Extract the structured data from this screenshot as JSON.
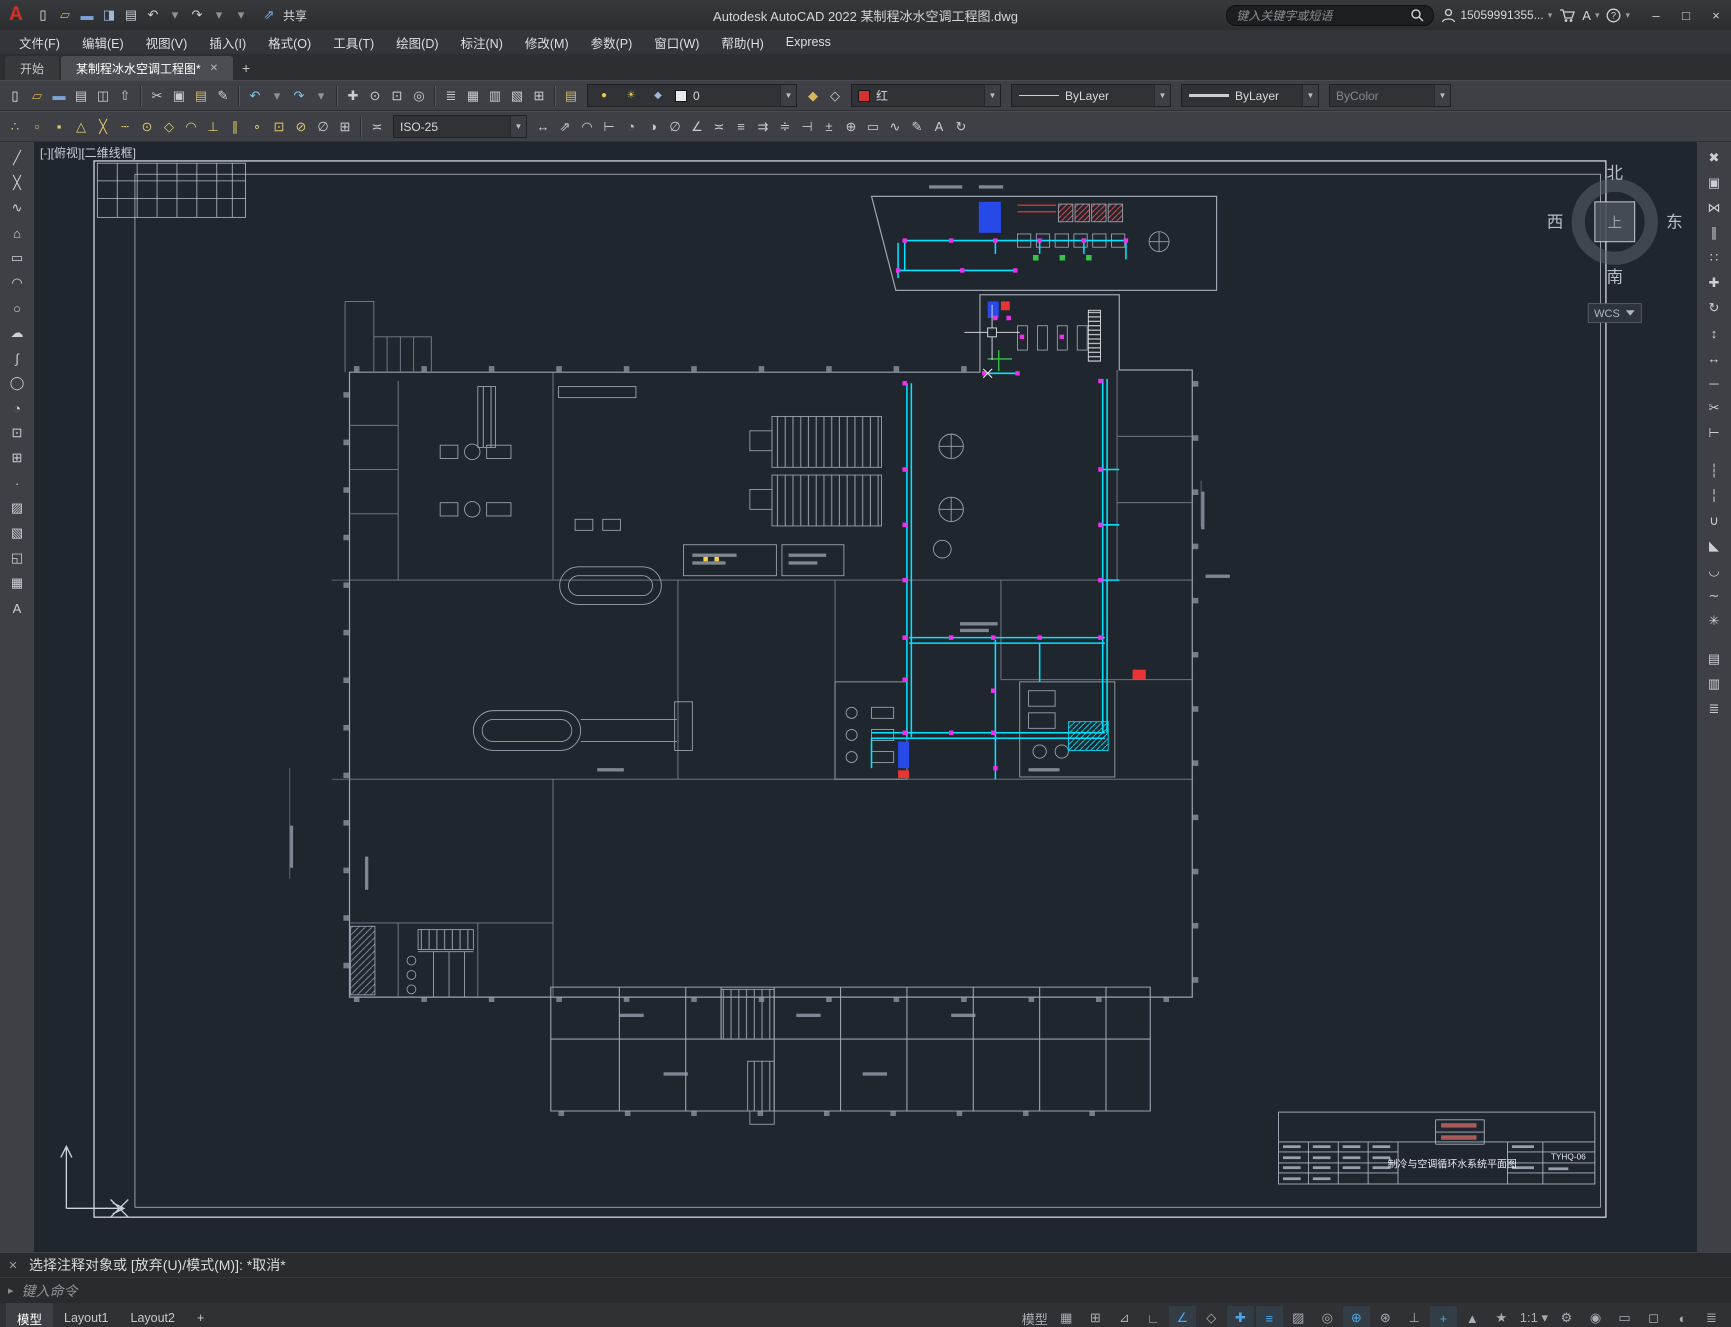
{
  "colors": {
    "canvas_bg": "#20262e",
    "pipe_cyan": "#00e4ff",
    "valve_magenta": "#ee30ee",
    "accent_red": "#d23232"
  },
  "titlebar": {
    "logo": "A",
    "quick_access": [
      {
        "name": "new-icon",
        "g": "▯",
        "c": "#e4e6e9"
      },
      {
        "name": "open-icon",
        "g": "▱",
        "c": "#d9a94f"
      },
      {
        "name": "save-icon",
        "g": "▬",
        "c": "#7da3d8"
      },
      {
        "name": "save-as-icon",
        "g": "◨",
        "c": "#9fb9dd"
      },
      {
        "name": "plot-icon",
        "g": "▤",
        "c": "#c9ccd1"
      },
      {
        "name": "undo-icon",
        "g": "↶",
        "c": "#cfd2d6"
      },
      {
        "name": "undo-caret-icon",
        "g": "▾",
        "c": "#8f9296"
      },
      {
        "name": "redo-icon",
        "g": "↷",
        "c": "#cfd2d6"
      },
      {
        "name": "redo-caret-icon",
        "g": "▾",
        "c": "#8f9296"
      },
      {
        "name": "qat-caret-icon",
        "g": "▾",
        "c": "#8f9296"
      }
    ],
    "share_icon": "⇗",
    "share_label": "共享",
    "title": "Autodesk AutoCAD 2022   某制程冰水空调工程图.dwg",
    "search_placeholder": "键入关键字或短语",
    "right_icons": [
      "search-icon",
      "user-icon",
      "cart-icon",
      "autodesk-a-icon",
      "help-icon"
    ],
    "user_name": "15059991355...",
    "help_label": "?",
    "window_controls": [
      {
        "name": "minimize-button",
        "g": "–"
      },
      {
        "name": "maximize-button",
        "g": "□"
      },
      {
        "name": "close-button",
        "g": "×"
      }
    ]
  },
  "menubar": {
    "items": [
      {
        "name": "menu-file",
        "label": "文件(F)"
      },
      {
        "name": "menu-edit",
        "label": "编辑(E)"
      },
      {
        "name": "menu-view",
        "label": "视图(V)"
      },
      {
        "name": "menu-insert",
        "label": "插入(I)"
      },
      {
        "name": "menu-format",
        "label": "格式(O)"
      },
      {
        "name": "menu-tools",
        "label": "工具(T)"
      },
      {
        "name": "menu-draw",
        "label": "绘图(D)"
      },
      {
        "name": "menu-dimension",
        "label": "标注(N)"
      },
      {
        "name": "menu-modify",
        "label": "修改(M)"
      },
      {
        "name": "menu-parametric",
        "label": "参数(P)"
      },
      {
        "name": "menu-window",
        "label": "窗口(W)"
      },
      {
        "name": "menu-help",
        "label": "帮助(H)"
      },
      {
        "name": "menu-express",
        "label": "Express"
      }
    ]
  },
  "filetabs": {
    "start": "开始",
    "active": "某制程冰水空调工程图*",
    "close": "✕",
    "add": "+"
  },
  "toolbar1": {
    "icons_a": [
      {
        "name": "qnew-icon",
        "g": "▯",
        "c": "#e4e6e9"
      },
      {
        "name": "open-icon",
        "g": "▱",
        "c": "#d9a94f"
      },
      {
        "name": "save-icon",
        "g": "▬",
        "c": "#7da3d8"
      },
      {
        "name": "plot-icon",
        "g": "▤",
        "c": "#c9ccd1"
      },
      {
        "name": "plot-preview-icon",
        "g": "◫",
        "c": "#c9ccd1"
      },
      {
        "name": "publish-icon",
        "g": "⇧",
        "c": "#c9ccd1"
      },
      {
        "sep": true
      },
      {
        "name": "cut-icon",
        "g": "✂",
        "c": "#c9ccd1"
      },
      {
        "name": "copy-clip-icon",
        "g": "▣",
        "c": "#c9ccd1"
      },
      {
        "name": "paste-icon",
        "g": "▤",
        "c": "#d8b65e"
      },
      {
        "name": "match-properties-icon",
        "g": "✎",
        "c": "#c9ccd1"
      },
      {
        "sep": true
      },
      {
        "name": "undo-icon",
        "g": "↶",
        "c": "#86c8e8"
      },
      {
        "name": "undo-caret-icon",
        "g": "▾",
        "c": "#8f9296"
      },
      {
        "name": "redo-icon",
        "g": "↷",
        "c": "#86c8e8"
      },
      {
        "name": "redo-caret-icon",
        "g": "▾",
        "c": "#8f9296"
      },
      {
        "sep": true
      },
      {
        "name": "pan-icon",
        "g": "✚",
        "c": "#c9ccd1"
      },
      {
        "name": "zoom-realtime-icon",
        "g": "⊙",
        "c": "#c9ccd1"
      },
      {
        "name": "zoom-window-icon",
        "g": "⊡",
        "c": "#c9ccd1"
      },
      {
        "name": "zoom-previous-icon",
        "g": "◎",
        "c": "#c9ccd1"
      },
      {
        "sep": true
      },
      {
        "name": "properties-icon",
        "g": "≣",
        "c": "#c9ccd1"
      },
      {
        "name": "designcenter-icon",
        "g": "▦",
        "c": "#c9ccd1"
      },
      {
        "name": "tool-palettes-icon",
        "g": "▥",
        "c": "#c9ccd1"
      },
      {
        "name": "sheet-set-icon",
        "g": "▧",
        "c": "#c9ccd1"
      },
      {
        "name": "calculator-icon",
        "g": "⊞",
        "c": "#c9ccd1"
      },
      {
        "sep": true
      },
      {
        "name": "layer-properties-icon",
        "g": "▤",
        "c": "#d8b65e"
      }
    ],
    "layer_combo": {
      "icons": [
        {
          "name": "layer-on-icon",
          "g": "●",
          "c": "#e8c84a"
        },
        {
          "name": "layer-thaw-icon",
          "g": "☀",
          "c": "#e8c84a"
        },
        {
          "name": "layer-lock-icon",
          "g": "◆",
          "c": "#9fb4d8"
        }
      ],
      "chip": "#e8eaed",
      "value": "0"
    },
    "icons_b": [
      {
        "name": "make-layer-current-icon",
        "g": "◆",
        "c": "#d8b65e"
      },
      {
        "name": "layer-previous-icon",
        "g": "◇",
        "c": "#c9ccd1"
      }
    ],
    "color_combo": {
      "chip": "#d23232",
      "value": "红"
    },
    "linetype_combo": {
      "value": "ByLayer"
    },
    "lineweight_combo": {
      "value": "ByLayer"
    },
    "plotstyle_combo": {
      "value": "ByColor"
    }
  },
  "toolbar2": {
    "icons_a": [
      {
        "name": "temporary-track-point-icon",
        "g": "∴",
        "c": "#d9c96a"
      },
      {
        "name": "snap-from-icon",
        "g": "▫",
        "c": "#d9c96a"
      },
      {
        "name": "snap-endpoint-icon",
        "g": "▪",
        "c": "#d9c96a"
      },
      {
        "name": "snap-midpoint-icon",
        "g": "△",
        "c": "#d9c96a"
      },
      {
        "name": "snap-intersection-icon",
        "g": "╳",
        "c": "#d9c96a"
      },
      {
        "name": "snap-extension-icon",
        "g": "┄",
        "c": "#d9c96a"
      },
      {
        "name": "snap-center-icon",
        "g": "⊙",
        "c": "#d9c96a"
      },
      {
        "name": "snap-quadrant-icon",
        "g": "◇",
        "c": "#d9c96a"
      },
      {
        "name": "snap-tangent-icon",
        "g": "◠",
        "c": "#d9c96a"
      },
      {
        "name": "snap-perpendicular-icon",
        "g": "⊥",
        "c": "#d9c96a"
      },
      {
        "name": "snap-parallel-icon",
        "g": "∥",
        "c": "#d9c96a"
      },
      {
        "name": "snap-node-icon",
        "g": "∘",
        "c": "#d9c96a"
      },
      {
        "name": "snap-insert-icon",
        "g": "⊡",
        "c": "#d9c96a"
      },
      {
        "name": "snap-nearest-icon",
        "g": "⊘",
        "c": "#d9c96a"
      },
      {
        "name": "snap-none-icon",
        "g": "∅",
        "c": "#c9ccd1"
      },
      {
        "name": "osnap-settings-icon",
        "g": "⊞",
        "c": "#c9ccd1"
      },
      {
        "sep": true
      },
      {
        "name": "dimstyle-icon",
        "g": "≍",
        "c": "#c9ccd1"
      }
    ],
    "dimstyle_combo": {
      "value": "ISO-25"
    },
    "icons_b": [
      {
        "name": "dim-linear-icon",
        "g": "↔",
        "c": "#c9ccd1"
      },
      {
        "name": "dim-aligned-icon",
        "g": "⇗",
        "c": "#c9ccd1"
      },
      {
        "name": "dim-arc-icon",
        "g": "◠",
        "c": "#c9ccd1"
      },
      {
        "name": "dim-ordinate-icon",
        "g": "⊢",
        "c": "#c9ccd1"
      },
      {
        "name": "dim-radius-icon",
        "g": "◔",
        "c": "#c9ccd1"
      },
      {
        "name": "dim-jogged-icon",
        "g": "◑",
        "c": "#c9ccd1"
      },
      {
        "name": "dim-diameter-icon",
        "g": "∅",
        "c": "#c9ccd1"
      },
      {
        "name": "dim-angular-icon",
        "g": "∠",
        "c": "#c9ccd1"
      },
      {
        "name": "quick-dim-icon",
        "g": "≍",
        "c": "#c9ccd1"
      },
      {
        "name": "dim-baseline-icon",
        "g": "≡",
        "c": "#c9ccd1"
      },
      {
        "name": "dim-continue-icon",
        "g": "⇉",
        "c": "#c9ccd1"
      },
      {
        "name": "dim-space-icon",
        "g": "≑",
        "c": "#c9ccd1"
      },
      {
        "name": "dim-break-icon",
        "g": "⊣",
        "c": "#c9ccd1"
      },
      {
        "name": "tolerance-icon",
        "g": "±",
        "c": "#c9ccd1"
      },
      {
        "name": "center-mark-icon",
        "g": "⊕",
        "c": "#c9ccd1"
      },
      {
        "name": "dim-inspect-icon",
        "g": "▭",
        "c": "#c9ccd1"
      },
      {
        "name": "dim-jogline-icon",
        "g": "∿",
        "c": "#c9ccd1"
      },
      {
        "name": "dim-edit-icon",
        "g": "✎",
        "c": "#c9ccd1"
      },
      {
        "name": "dim-text-edit-icon",
        "g": "A",
        "c": "#c9ccd1"
      },
      {
        "name": "dim-update-icon",
        "g": "↻",
        "c": "#c9ccd1"
      }
    ]
  },
  "palette_left": {
    "icons": [
      {
        "name": "line-tool-icon",
        "g": "╱",
        "c": "#ccd0d5"
      },
      {
        "name": "construction-line-tool-icon",
        "g": "╳",
        "c": "#ccd0d5"
      },
      {
        "name": "polyline-tool-icon",
        "g": "∿",
        "c": "#ccd0d5"
      },
      {
        "name": "polygon-tool-icon",
        "g": "⌂",
        "c": "#ccd0d5"
      },
      {
        "name": "rectangle-tool-icon",
        "g": "▭",
        "c": "#ccd0d5"
      },
      {
        "name": "arc-tool-icon",
        "g": "◠",
        "c": "#ccd0d5"
      },
      {
        "name": "circle-tool-icon",
        "g": "○",
        "c": "#ccd0d5"
      },
      {
        "name": "revision-cloud-tool-icon",
        "g": "☁",
        "c": "#ccd0d5"
      },
      {
        "name": "spline-tool-icon",
        "g": "∫",
        "c": "#ccd0d5"
      },
      {
        "name": "ellipse-tool-icon",
        "g": "◯",
        "c": "#ccd0d5"
      },
      {
        "name": "ellipse-arc-tool-icon",
        "g": "◔",
        "c": "#ccd0d5"
      },
      {
        "name": "insert-block-tool-icon",
        "g": "⊡",
        "c": "#ccd0d5"
      },
      {
        "name": "make-block-tool-icon",
        "g": "⊞",
        "c": "#ccd0d5"
      },
      {
        "name": "point-tool-icon",
        "g": "∙",
        "c": "#ccd0d5"
      },
      {
        "name": "hatch-tool-icon",
        "g": "▨",
        "c": "#ccd0d5"
      },
      {
        "name": "gradient-tool-icon",
        "g": "▧",
        "c": "#ccd0d5"
      },
      {
        "name": "region-tool-icon",
        "g": "◱",
        "c": "#ccd0d5"
      },
      {
        "name": "table-tool-icon",
        "g": "▦",
        "c": "#ccd0d5"
      },
      {
        "name": "multiline-text-tool-icon",
        "g": "A",
        "c": "#ccd0d5"
      }
    ]
  },
  "palette_right": {
    "icons": [
      {
        "name": "erase-tool-icon",
        "g": "✖",
        "c": "#ccd0d5"
      },
      {
        "name": "copy-tool-icon",
        "g": "▣",
        "c": "#ccd0d5"
      },
      {
        "name": "mirror-tool-icon",
        "g": "⋈",
        "c": "#ccd0d5"
      },
      {
        "name": "offset-tool-icon",
        "g": "∥",
        "c": "#ccd0d5"
      },
      {
        "name": "array-tool-icon",
        "g": "∷",
        "c": "#ccd0d5"
      },
      {
        "name": "move-tool-icon",
        "g": "✚",
        "c": "#ccd0d5"
      },
      {
        "name": "rotate-tool-icon",
        "g": "↻",
        "c": "#ccd0d5"
      },
      {
        "name": "scale-tool-icon",
        "g": "↕",
        "c": "#ccd0d5"
      },
      {
        "name": "stretch-tool-icon",
        "g": "↔",
        "c": "#ccd0d5"
      },
      {
        "name": "lengthen-tool-icon",
        "g": "─",
        "c": "#ccd0d5"
      },
      {
        "name": "trim-tool-icon",
        "g": "✂",
        "c": "#ccd0d5"
      },
      {
        "name": "extend-tool-icon",
        "g": "⊢",
        "c": "#ccd0d5"
      },
      {
        "sep": true
      },
      {
        "name": "break-at-point-tool-icon",
        "g": "┆",
        "c": "#ccd0d5"
      },
      {
        "name": "break-tool-icon",
        "g": "╎",
        "c": "#ccd0d5"
      },
      {
        "name": "join-tool-icon",
        "g": "∪",
        "c": "#ccd0d5"
      },
      {
        "name": "chamfer-tool-icon",
        "g": "◣",
        "c": "#ccd0d5"
      },
      {
        "name": "fillet-tool-icon",
        "g": "◡",
        "c": "#ccd0d5"
      },
      {
        "name": "blend-curves-tool-icon",
        "g": "∼",
        "c": "#ccd0d5"
      },
      {
        "name": "explode-tool-icon",
        "g": "✳",
        "c": "#ccd0d5"
      },
      {
        "sep": true
      },
      {
        "name": "group-tool-icon",
        "g": "▤",
        "c": "#ccd0d5"
      },
      {
        "name": "ungroup-tool-icon",
        "g": "▥",
        "c": "#ccd0d5"
      },
      {
        "name": "properties-tool-icon",
        "g": "≣",
        "c": "#ccd0d5"
      }
    ]
  },
  "canvas": {
    "viewport_controls": "[-][俯视][二维线框]",
    "viewcube": {
      "n": "北",
      "w": "西",
      "e": "东",
      "s": "南",
      "top": "上",
      "wcs": "WCS"
    },
    "titleblock": {
      "title": "制冷与空调循环水系统平面图",
      "drawing_no": "TYHQ-06"
    }
  },
  "commandline": {
    "close": "✕",
    "history": "选择注释对象或 [放弃(U)/模式(M)]: *取消*",
    "prompt_icon": "▸",
    "prompt": "键入命令"
  },
  "statusbar": {
    "tabs": [
      {
        "name": "model-tab",
        "label": "模型",
        "active": true
      },
      {
        "name": "layout1-tab",
        "label": "Layout1"
      },
      {
        "name": "layout2-tab",
        "label": "Layout2"
      },
      {
        "name": "new-layout-tab",
        "label": "+"
      }
    ],
    "right": [
      {
        "name": "model-paper-toggle",
        "g": "模型"
      },
      {
        "name": "grid-icon",
        "g": "▦"
      },
      {
        "name": "snap-mode-icon",
        "g": "⊞"
      },
      {
        "name": "infer-constraints-icon",
        "g": "⊿"
      },
      {
        "name": "ortho-icon",
        "g": "∟"
      },
      {
        "name": "polar-tracking-icon",
        "g": "∠",
        "active": true
      },
      {
        "name": "isometric-draft-icon",
        "g": "◇"
      },
      {
        "name": "object-snap-tracking-icon",
        "g": "✚",
        "active": true
      },
      {
        "name": "lineweight-display-icon",
        "g": "≡",
        "active": true
      },
      {
        "name": "transparency-icon",
        "g": "▨"
      },
      {
        "name": "selection-cycling-icon",
        "g": "◎"
      },
      {
        "name": "object-snap-icon",
        "g": "⊕",
        "active": true
      },
      {
        "name": "3d-object-snap-icon",
        "g": "⊛"
      },
      {
        "name": "dynamic-ucs-icon",
        "g": "⊥"
      },
      {
        "name": "dynamic-input-icon",
        "g": "+",
        "active": true
      },
      {
        "name": "annotation-visibility-icon",
        "g": "▲"
      },
      {
        "name": "autoscale-icon",
        "g": "★"
      },
      {
        "name": "annotation-scale",
        "g": "1:1 ▾"
      },
      {
        "name": "workspace-switching-icon",
        "g": "⚙"
      },
      {
        "name": "annotation-monitor-icon",
        "g": "◉"
      },
      {
        "name": "quick-properties-icon",
        "g": "▭"
      },
      {
        "name": "lock-ui-icon",
        "g": "◻"
      },
      {
        "name": "isolate-objects-icon",
        "g": "◐"
      },
      {
        "name": "customize-icon",
        "g": "≣"
      }
    ]
  }
}
